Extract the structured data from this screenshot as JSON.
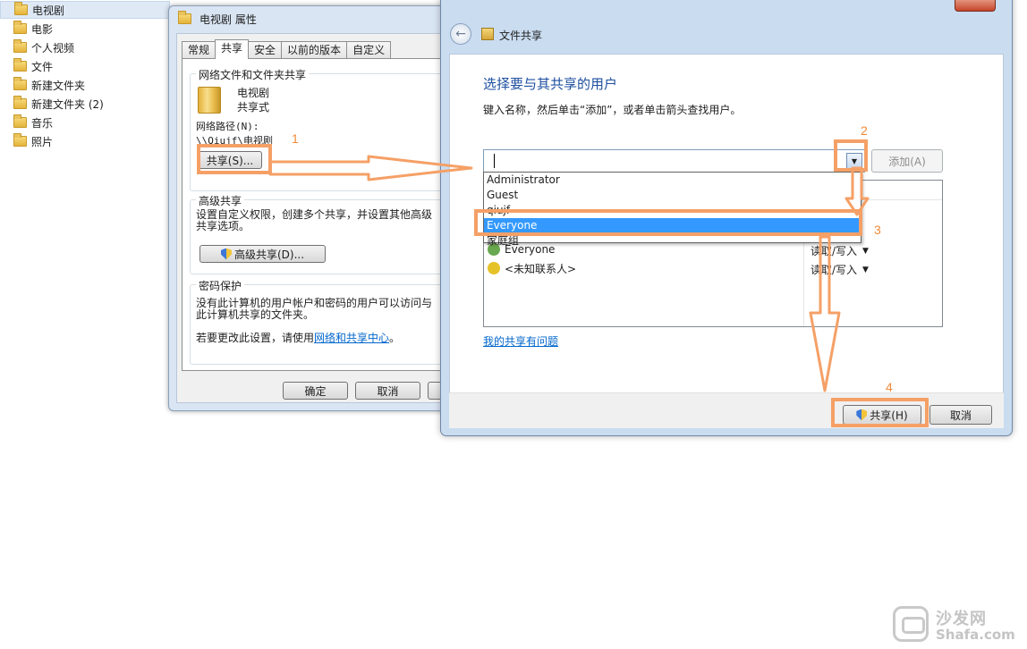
{
  "explorer": {
    "nav_items": [
      {
        "label": "电视剧",
        "selected": true
      },
      {
        "label": "电影"
      },
      {
        "label": "个人视频"
      },
      {
        "label": "文件"
      },
      {
        "label": "新建文件夹"
      },
      {
        "label": "新建文件夹 (2)"
      },
      {
        "label": "音乐"
      },
      {
        "label": "照片"
      }
    ]
  },
  "properties_dialog": {
    "title": "电视剧 属性",
    "tabs": [
      "常规",
      "共享",
      "安全",
      "以前的版本",
      "自定义"
    ],
    "active_tab": "共享",
    "network_sharing": {
      "group_title": "网络文件和文件夹共享",
      "folder_name": "电视剧",
      "share_state": "共享式",
      "path_label": "网络路径(N):",
      "path_value": "\\\\Qiujf\\电视剧",
      "share_button": "共享(S)..."
    },
    "advanced_sharing": {
      "group_title": "高级共享",
      "description": "设置自定义权限，创建多个共享，并设置其他高级共享选项。",
      "button": "高级共享(D)..."
    },
    "password_protection": {
      "group_title": "密码保护",
      "description": "没有此计算机的用户帐户和密码的用户可以访问与此计算机共享的文件夹。",
      "change_prefix": "若要更改此设置，请使用",
      "link_text": "网络和共享中心",
      "change_suffix": "。"
    },
    "buttons": {
      "ok": "确定",
      "cancel": "取消"
    }
  },
  "file_sharing_dialog": {
    "title": "文件共享",
    "heading": "选择要与其共享的用户",
    "instruction": "键入名称，然后单击“添加”，或者单击箭头查找用户。",
    "input_value": "",
    "add_button": "添加(A)",
    "dropdown_options": [
      "Administrator",
      "Guest",
      "qiujf",
      "Everyone",
      "家庭组"
    ],
    "highlighted_option": "Everyone",
    "users": [
      {
        "name": "Everyone",
        "permission": "读取/写入",
        "color": "#6aa84f"
      },
      {
        "name": "<未知联系人>",
        "permission": "读取/写入",
        "color": "#e6c229"
      }
    ],
    "help_link": "我的共享有问题",
    "share_button": "共享(H)",
    "cancel_button": "取消"
  },
  "annotations": {
    "steps": [
      "1",
      "2",
      "3",
      "4"
    ],
    "highlight_color": "#f5a066"
  },
  "watermark": {
    "name_cn": "沙发网",
    "domain": "Shafa.com"
  }
}
